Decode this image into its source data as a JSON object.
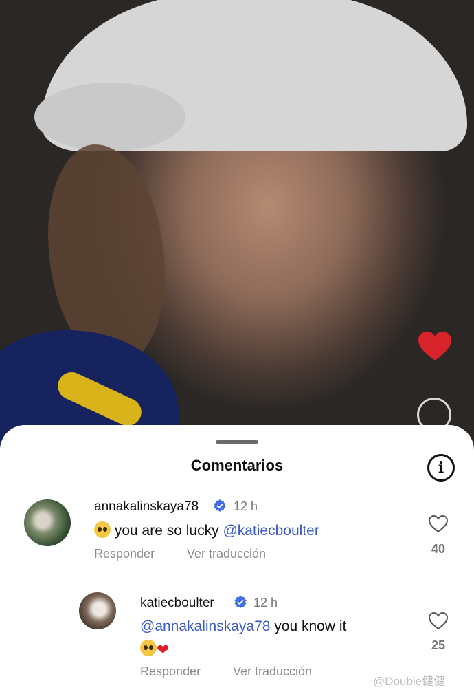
{
  "background": {
    "description_icon": "video-frame",
    "accent_heart_color": "#d7232a"
  },
  "sheet": {
    "title": "Comentarios",
    "info_icon": "i"
  },
  "comments": [
    {
      "username": "annakalinskaya78",
      "time": "12 h",
      "text": "you are so lucky",
      "mention": "@katiecboulter",
      "reply_label": "Responder",
      "translate_label": "Ver traducción",
      "likes": "40"
    },
    {
      "username": "katiecboulter",
      "time": "12 h",
      "mention": "@annakalinskaya78",
      "text": "you know it",
      "reply_label": "Responder",
      "translate_label": "Ver traducción",
      "likes": "25"
    }
  ],
  "watermark": "@Double健健",
  "colors": {
    "mention": "#3b5bc9",
    "verified": "#3f6fe0",
    "muted": "#8a8a8a"
  }
}
